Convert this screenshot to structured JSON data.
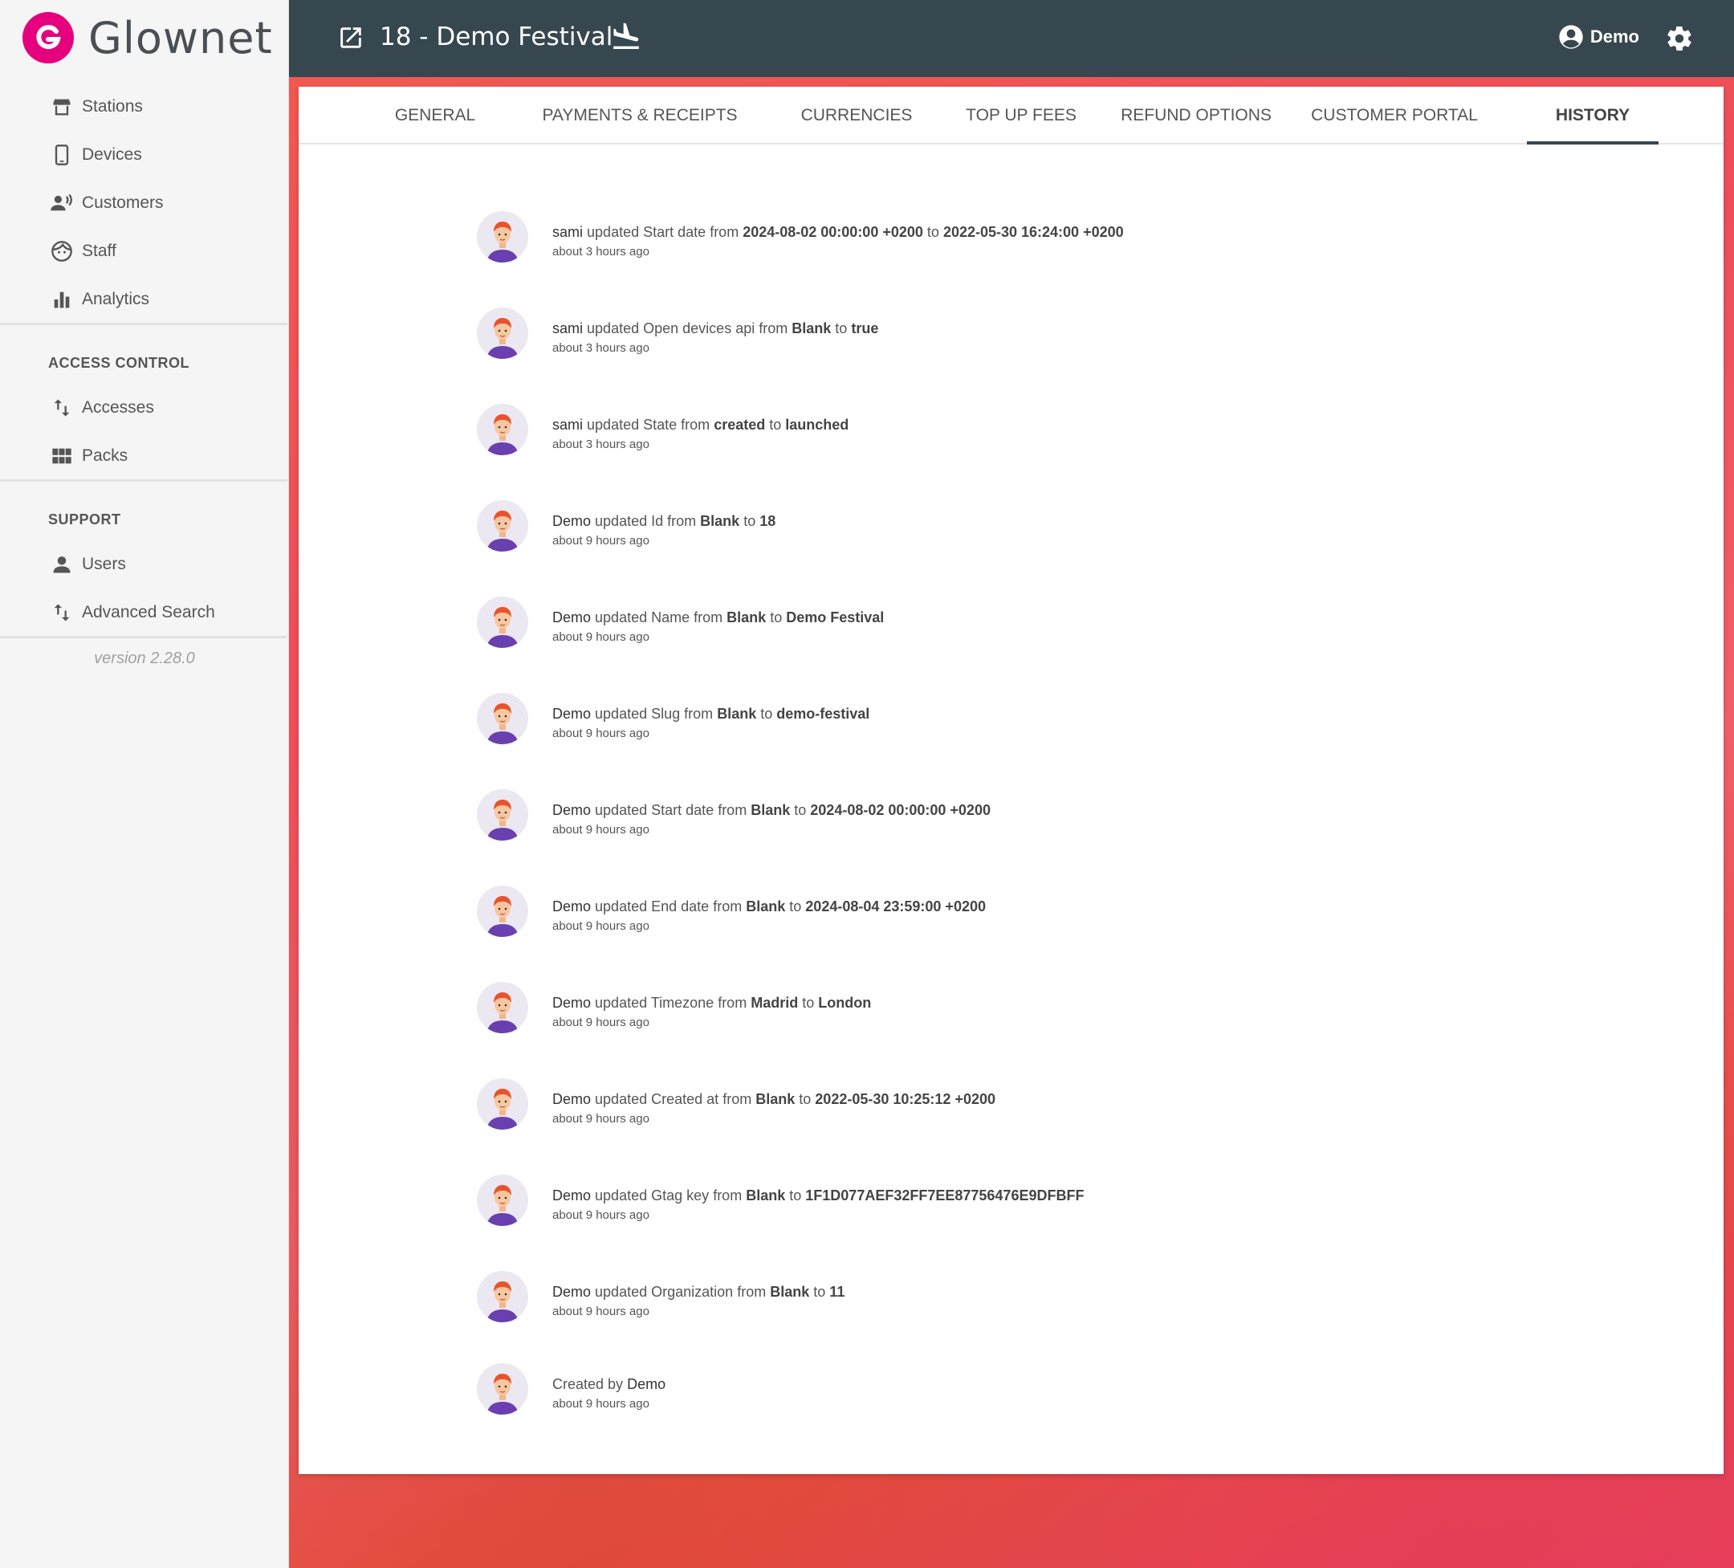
{
  "app": {
    "name": "Glownet",
    "version": "version 2.28.0"
  },
  "topbar": {
    "title": "18 - Demo Festival",
    "user": "Demo"
  },
  "sidebar": {
    "items": [
      {
        "label": "Stations",
        "icon": "store-icon"
      },
      {
        "label": "Devices",
        "icon": "phone-icon"
      },
      {
        "label": "Customers",
        "icon": "customers-icon"
      },
      {
        "label": "Staff",
        "icon": "face-icon"
      },
      {
        "label": "Analytics",
        "icon": "bar-chart-icon"
      }
    ],
    "access_control": {
      "title": "ACCESS CONTROL",
      "items": [
        {
          "label": "Accesses",
          "icon": "swap-vert-icon"
        },
        {
          "label": "Packs",
          "icon": "grid-icon"
        }
      ]
    },
    "support": {
      "title": "SUPPORT",
      "items": [
        {
          "label": "Users",
          "icon": "person-icon"
        },
        {
          "label": "Advanced Search",
          "icon": "swap-vert-icon"
        }
      ]
    }
  },
  "tabs": [
    {
      "label": "GENERAL"
    },
    {
      "label": "PAYMENTS & RECEIPTS"
    },
    {
      "label": "CURRENCIES"
    },
    {
      "label": "TOP UP FEES"
    },
    {
      "label": "REFUND OPTIONS"
    },
    {
      "label": "CUSTOMER PORTAL"
    },
    {
      "label": "HISTORY",
      "active": true
    }
  ],
  "history": [
    {
      "user": "sami",
      "verb": "updated",
      "field": "Start date",
      "from_word": "from",
      "from": "2024-08-02 00:00:00 +0200",
      "to_word": "to",
      "to": "2022-05-30 16:24:00 +0200",
      "time": "about 3 hours ago"
    },
    {
      "user": "sami",
      "verb": "updated",
      "field": "Open devices api",
      "from_word": "from",
      "from": "Blank",
      "to_word": "to",
      "to": "true",
      "time": "about 3 hours ago"
    },
    {
      "user": "sami",
      "verb": "updated",
      "field": "State",
      "from_word": "from",
      "from": "created",
      "to_word": "to",
      "to": "launched",
      "time": "about 3 hours ago"
    },
    {
      "user": "Demo",
      "verb": "updated",
      "field": "Id",
      "from_word": "from",
      "from": "Blank",
      "to_word": "to",
      "to": "18",
      "time": "about 9 hours ago"
    },
    {
      "user": "Demo",
      "verb": "updated",
      "field": "Name",
      "from_word": "from",
      "from": "Blank",
      "to_word": "to",
      "to": "Demo Festival",
      "time": "about 9 hours ago"
    },
    {
      "user": "Demo",
      "verb": "updated",
      "field": "Slug",
      "from_word": "from",
      "from": "Blank",
      "to_word": "to",
      "to": "demo-festival",
      "time": "about 9 hours ago"
    },
    {
      "user": "Demo",
      "verb": "updated",
      "field": "Start date",
      "from_word": "from",
      "from": "Blank",
      "to_word": "to",
      "to": "2024-08-02 00:00:00 +0200",
      "time": "about 9 hours ago"
    },
    {
      "user": "Demo",
      "verb": "updated",
      "field": "End date",
      "from_word": "from",
      "from": "Blank",
      "to_word": "to",
      "to": "2024-08-04 23:59:00 +0200",
      "time": "about 9 hours ago"
    },
    {
      "user": "Demo",
      "verb": "updated",
      "field": "Timezone",
      "from_word": "from",
      "from": "Madrid",
      "to_word": "to",
      "to": "London",
      "time": "about 9 hours ago"
    },
    {
      "user": "Demo",
      "verb": "updated",
      "field": "Created at",
      "from_word": "from",
      "from": "Blank",
      "to_word": "to",
      "to": "2022-05-30 10:25:12 +0200",
      "time": "about 9 hours ago"
    },
    {
      "user": "Demo",
      "verb": "updated",
      "field": "Gtag key",
      "from_word": "from",
      "from": "Blank",
      "to_word": "to",
      "to": "1F1D077AEF32FF7EE87756476E9DFBFF",
      "time": "about 9 hours ago"
    },
    {
      "user": "Demo",
      "verb": "updated",
      "field": "Organization",
      "from_word": "from",
      "from": "Blank",
      "to_word": "to",
      "to": "11",
      "time": "about 9 hours ago"
    }
  ],
  "created": {
    "prefix": "Created by",
    "user": "Demo",
    "time": "about 9 hours ago"
  },
  "colors": {
    "brand": "#e6007e",
    "topbar": "#37474f",
    "background_accent": "#f15a4f"
  }
}
